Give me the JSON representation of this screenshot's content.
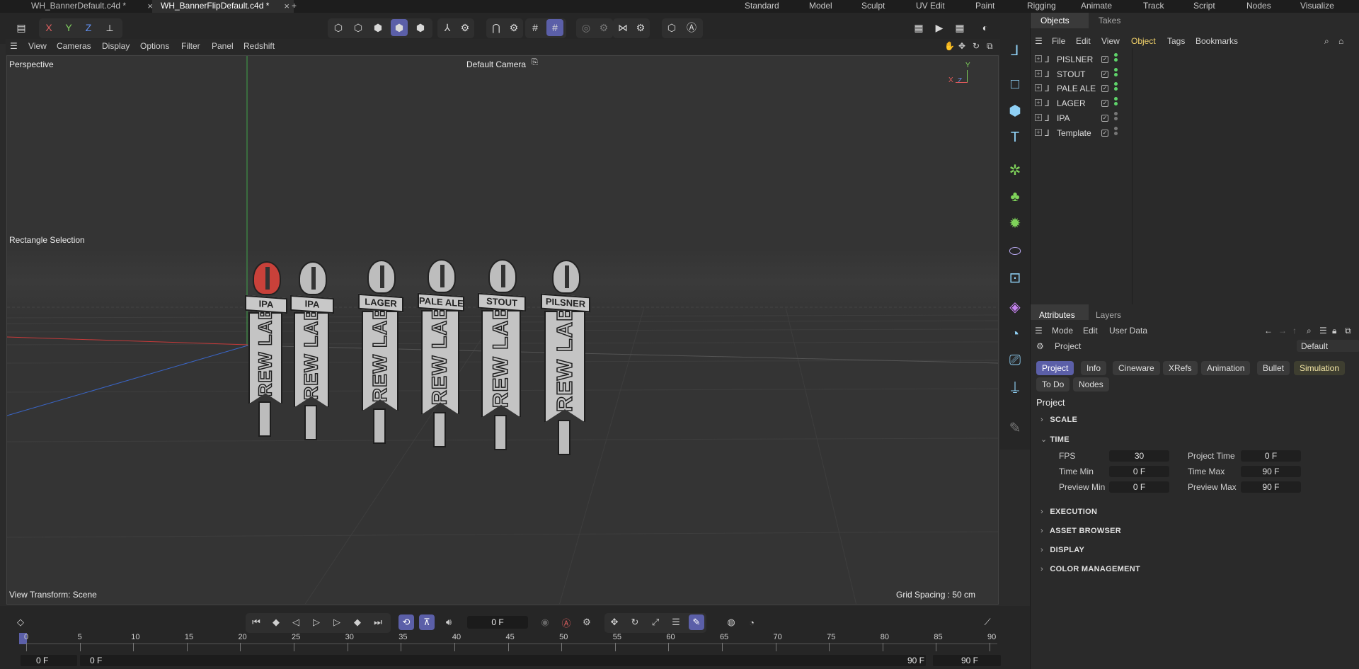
{
  "tabs": [
    {
      "label": "WH_BannerDefault.c4d *",
      "close": "×"
    },
    {
      "label": "WH_BannerFlipDefault.c4d *",
      "close": "×"
    }
  ],
  "new_tab": "+",
  "layouts": [
    "Standard",
    "Model",
    "Sculpt",
    "UV Edit",
    "Paint",
    "Rigging",
    "Animate",
    "Track",
    "Script",
    "Nodes",
    "Visualize"
  ],
  "axes": {
    "x": "X",
    "y": "Y",
    "z": "Z"
  },
  "viewport_menu": [
    "View",
    "Cameras",
    "Display",
    "Options",
    "Filter",
    "Panel",
    "Redshift"
  ],
  "viewport": {
    "mode": "Perspective",
    "camera": "Default Camera",
    "tool": "Rectangle Selection",
    "view_transform": "View Transform: Scene",
    "grid_spacing": "Grid Spacing : 50 cm",
    "axis_x": "X",
    "axis_y": "Y",
    "axis_z": "Z"
  },
  "handles": [
    {
      "top": "IPA",
      "body": "BREW LAB"
    },
    {
      "top": "IPA",
      "body": "BREW LAB"
    },
    {
      "top": "LAGER",
      "body": "BREW LAB"
    },
    {
      "top": "PALE ALE",
      "body": "BREW LAB"
    },
    {
      "top": "STOUT",
      "body": "BREW LAB"
    },
    {
      "top": "PILSNER",
      "body": "BREW LAB"
    }
  ],
  "objects_panel": {
    "tabs": [
      "Objects",
      "Takes"
    ],
    "menu": [
      "File",
      "Edit",
      "View",
      "Object",
      "Tags",
      "Bookmarks"
    ],
    "items": [
      {
        "name": "PISLNER",
        "dots": "green"
      },
      {
        "name": "STOUT",
        "dots": "green"
      },
      {
        "name": "PALE ALE",
        "dots": "green"
      },
      {
        "name": "LAGER",
        "dots": "green"
      },
      {
        "name": "IPA",
        "dots": "grey"
      },
      {
        "name": "Template",
        "dots": "grey"
      }
    ]
  },
  "attributes_panel": {
    "tabs": [
      "Attributes",
      "Layers"
    ],
    "menu": [
      "Mode",
      "Edit",
      "User Data"
    ],
    "object": "Project",
    "preset": "Default",
    "subtabs": [
      "Project",
      "Info",
      "Cineware",
      "XRefs",
      "Animation",
      "Bullet",
      "Simulation"
    ],
    "subtabs2": [
      "To Do",
      "Nodes"
    ],
    "heading": "Project",
    "sections": [
      "SCALE",
      "TIME",
      "EXECUTION",
      "ASSET BROWSER",
      "DISPLAY",
      "COLOR MANAGEMENT"
    ],
    "time": {
      "fps_label": "FPS",
      "fps": "30",
      "project_time_label": "Project Time",
      "project_time": "0 F",
      "time_min_label": "Time Min",
      "time_min": "0 F",
      "time_max_label": "Time Max",
      "time_max": "90 F",
      "preview_min_label": "Preview Min",
      "preview_min": "0 F",
      "preview_max_label": "Preview Max",
      "preview_max": "90 F"
    }
  },
  "timeline": {
    "current_frame": "0 F",
    "ticks": [
      "0",
      "5",
      "10",
      "15",
      "20",
      "25",
      "30",
      "35",
      "40",
      "45",
      "50",
      "55",
      "60",
      "65",
      "70",
      "75",
      "80",
      "85",
      "90"
    ],
    "start": "0 F",
    "preview_start": "0 F",
    "preview_end": "90 F",
    "end": "90 F"
  },
  "colors": {
    "accent": "#5b5fa8",
    "green": "#5fd36a",
    "axis_red": "#c63a3a",
    "axis_green": "#3fa34a",
    "axis_blue": "#3a66c9"
  }
}
